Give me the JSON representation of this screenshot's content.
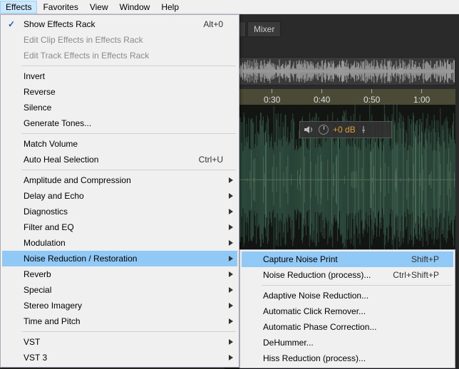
{
  "menubar": {
    "items": [
      "Effects",
      "Favorites",
      "View",
      "Window",
      "Help"
    ],
    "active_index": 0
  },
  "tabs": {
    "mixer": "Mixer"
  },
  "time_ruler": {
    "ticks": [
      {
        "pos": 55,
        "label": "0:30"
      },
      {
        "pos": 125,
        "label": "0:40"
      },
      {
        "pos": 195,
        "label": "0:50"
      },
      {
        "pos": 265,
        "label": "1:00"
      }
    ]
  },
  "hud": {
    "db_label": "+0 dB"
  },
  "effects_menu": {
    "sections": [
      [
        {
          "label": "Show Effects Rack",
          "shortcut": "Alt+0",
          "checked": true
        },
        {
          "label": "Edit Clip Effects in Effects Rack",
          "disabled": true
        },
        {
          "label": "Edit Track Effects in Effects Rack",
          "disabled": true
        }
      ],
      [
        {
          "label": "Invert"
        },
        {
          "label": "Reverse"
        },
        {
          "label": "Silence"
        },
        {
          "label": "Generate Tones..."
        }
      ],
      [
        {
          "label": "Match Volume"
        },
        {
          "label": "Auto Heal Selection",
          "shortcut": "Ctrl+U"
        }
      ],
      [
        {
          "label": "Amplitude and Compression",
          "submenu": true
        },
        {
          "label": "Delay and Echo",
          "submenu": true
        },
        {
          "label": "Diagnostics",
          "submenu": true
        },
        {
          "label": "Filter and EQ",
          "submenu": true
        },
        {
          "label": "Modulation",
          "submenu": true
        },
        {
          "label": "Noise Reduction / Restoration",
          "submenu": true,
          "highlight": true
        },
        {
          "label": "Reverb",
          "submenu": true
        },
        {
          "label": "Special",
          "submenu": true
        },
        {
          "label": "Stereo Imagery",
          "submenu": true
        },
        {
          "label": "Time and Pitch",
          "submenu": true
        }
      ],
      [
        {
          "label": "VST",
          "submenu": true
        },
        {
          "label": "VST 3",
          "submenu": true
        }
      ]
    ]
  },
  "noise_submenu": {
    "sections": [
      [
        {
          "label": "Capture Noise Print",
          "shortcut": "Shift+P",
          "highlight": true
        },
        {
          "label": "Noise Reduction (process)...",
          "shortcut": "Ctrl+Shift+P"
        }
      ],
      [
        {
          "label": "Adaptive Noise Reduction..."
        },
        {
          "label": "Automatic Click Remover..."
        },
        {
          "label": "Automatic Phase Correction..."
        },
        {
          "label": "DeHummer..."
        },
        {
          "label": "Hiss Reduction (process)..."
        }
      ]
    ]
  }
}
